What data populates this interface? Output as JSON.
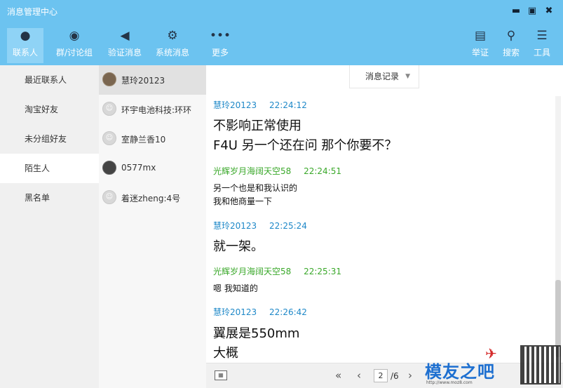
{
  "window": {
    "title": "消息管理中心",
    "controls": [
      "minimize",
      "maximize",
      "close"
    ]
  },
  "nav": {
    "left": [
      {
        "label": "联系人",
        "icon": "person-icon"
      },
      {
        "label": "群/讨论组",
        "icon": "group-icon"
      },
      {
        "label": "验证消息",
        "icon": "speaker-icon"
      },
      {
        "label": "系统消息",
        "icon": "gear-icon"
      },
      {
        "label": "更多",
        "icon": "more-dots-icon"
      }
    ],
    "right": [
      {
        "label": "举证",
        "icon": "document-icon"
      },
      {
        "label": "搜索",
        "icon": "search-icon"
      },
      {
        "label": "工具",
        "icon": "list-icon"
      }
    ],
    "active": "联系人"
  },
  "categories": [
    "最近联系人",
    "淘宝好友",
    "未分组好友",
    "陌生人",
    "黑名单"
  ],
  "active_category": "陌生人",
  "contacts": [
    {
      "name": "慧玲20123",
      "avatar": "photo"
    },
    {
      "name": "环宇电池科技:环环",
      "avatar": "default"
    },
    {
      "name": "室静兰香10",
      "avatar": "default"
    },
    {
      "name": "0577mx",
      "avatar": "dark"
    },
    {
      "name": "着迷zheng:4号",
      "avatar": "default"
    }
  ],
  "selected_contact": "慧玲20123",
  "chat": {
    "dropdown_label": "消息记录",
    "messages": [
      {
        "name": "慧玲20123",
        "time": "22:24:12",
        "lines": [
          " 不影响正常使用",
          "F4U  另一个还在问  那个你要不？"
        ],
        "size": "big"
      },
      {
        "name": "光辉岁月海阔天空58",
        "time": "22:24:51",
        "lines": [
          "另一个也是和我认识的",
          "我和他商量一下"
        ],
        "size": "small"
      },
      {
        "name": "慧玲20123",
        "time": "22:25:24",
        "lines": [
          "就一架。"
        ],
        "size": "big"
      },
      {
        "name": "光辉岁月海阔天空58",
        "time": "22:25:31",
        "lines": [
          "嗯  我知道的"
        ],
        "size": "small"
      },
      {
        "name": "慧玲20123",
        "time": "22:26:42",
        "lines": [
          " 翼展是550mm",
          "大概"
        ],
        "size": "big"
      }
    ]
  },
  "pagination": {
    "current": "2",
    "total": "/6"
  },
  "watermark": {
    "text": "模友之吧",
    "url": "http://www.moz8.com"
  },
  "colors": {
    "header": "#6cc3f0",
    "blue_name": "#1e88c8",
    "green_name": "#3aa82a"
  }
}
